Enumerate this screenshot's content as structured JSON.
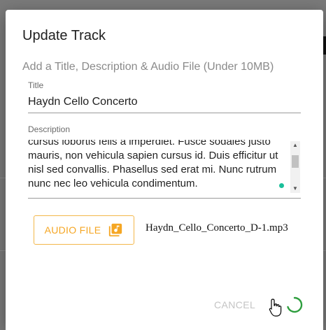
{
  "dialog": {
    "title": "Update Track",
    "subtitle": "Add a Title, Description & Audio File (Under 10MB)"
  },
  "title_field": {
    "label": "Title",
    "value": "Haydn Cello Concerto"
  },
  "description_field": {
    "label": "Description",
    "value": "cursus lobortis felis a imperdiet. Fusce sodales justo mauris, non vehicula sapien cursus id. Duis efficitur ut nisl sed convallis. Phasellus sed erat mi. Nunc rutrum nunc nec leo vehicula condimentum."
  },
  "audio": {
    "button_label": "AUDIO FILE",
    "icon": "music-file-icon",
    "file_name": "Haydn_Cello_Concerto_D-1.mp3"
  },
  "actions": {
    "cancel_label": "CANCEL",
    "spinner_icon": "loading-spinner-icon"
  },
  "colors": {
    "accent": "#f5a623",
    "spinner": "#2e9e3e",
    "grammar_dot": "#1bbf9a"
  }
}
